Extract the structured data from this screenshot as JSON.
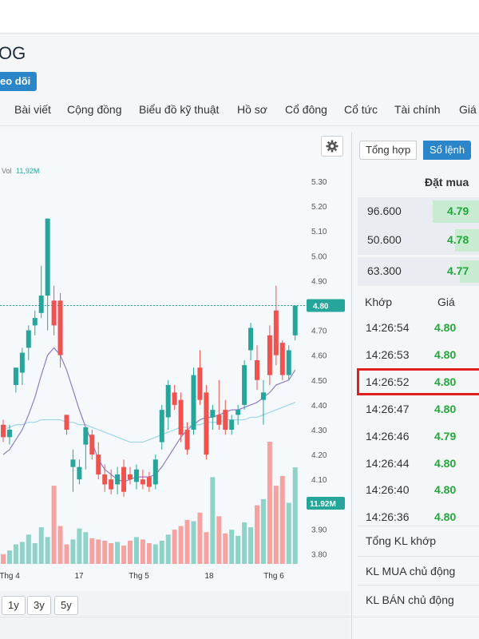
{
  "header": {
    "ticker": "OG",
    "follow_label": "eo dõi"
  },
  "tabs": [
    "Bài viết",
    "Cộng đồng",
    "Biểu đồ kỹ thuật",
    "Hồ sơ",
    "Cổ đông",
    "Cổ tức",
    "Tài chính",
    "Giá"
  ],
  "chart_data": {
    "type": "candlestick",
    "volume_label": "Vol",
    "volume_value": "11,92M",
    "last_price_label": "4.80",
    "last_volume_label": "11.92M",
    "y_ticks": [
      "5.30",
      "5.20",
      "5.10",
      "5.00",
      "4.90",
      "4.80",
      "4.70",
      "4.60",
      "4.50",
      "4.40",
      "4.30",
      "4.20",
      "4.10",
      "4.00",
      "3.90",
      "3.80"
    ],
    "x_ticks": [
      "Thg 4",
      "17",
      "Thg 5",
      "18",
      "Thg 6"
    ],
    "candles": [
      {
        "o": 4.32,
        "h": 4.34,
        "l": 4.25,
        "c": 4.27
      },
      {
        "o": 4.27,
        "h": 4.32,
        "l": 4.24,
        "c": 4.3
      },
      {
        "o": 4.48,
        "h": 4.55,
        "l": 4.45,
        "c": 4.55
      },
      {
        "o": 4.53,
        "h": 4.63,
        "l": 4.48,
        "c": 4.61
      },
      {
        "o": 4.63,
        "h": 4.72,
        "l": 4.58,
        "c": 4.7
      },
      {
        "o": 4.72,
        "h": 4.78,
        "l": 4.68,
        "c": 4.75
      },
      {
        "o": 4.77,
        "h": 4.96,
        "l": 4.75,
        "c": 4.84
      },
      {
        "o": 4.84,
        "h": 5.15,
        "l": 4.7,
        "c": 5.15
      },
      {
        "o": 4.82,
        "h": 4.88,
        "l": 4.68,
        "c": 4.72
      },
      {
        "o": 4.82,
        "h": 4.85,
        "l": 4.55,
        "c": 4.6
      },
      {
        "o": 4.36,
        "h": 4.36,
        "l": 4.28,
        "c": 4.3
      },
      {
        "o": 4.15,
        "h": 4.22,
        "l": 4.05,
        "c": 4.18
      },
      {
        "o": 4.1,
        "h": 4.18,
        "l": 4.08,
        "c": 4.15
      },
      {
        "o": 4.24,
        "h": 4.31,
        "l": 4.14,
        "c": 4.31
      },
      {
        "o": 4.28,
        "h": 4.3,
        "l": 4.18,
        "c": 4.2
      },
      {
        "o": 4.2,
        "h": 4.25,
        "l": 4.1,
        "c": 4.12
      },
      {
        "o": 4.12,
        "h": 4.16,
        "l": 4.05,
        "c": 4.08
      },
      {
        "o": 4.1,
        "h": 4.14,
        "l": 4.04,
        "c": 4.06
      },
      {
        "o": 4.08,
        "h": 4.15,
        "l": 4.04,
        "c": 4.12
      },
      {
        "o": 4.15,
        "h": 4.18,
        "l": 4.03,
        "c": 4.05
      },
      {
        "o": 4.12,
        "h": 4.15,
        "l": 4.08,
        "c": 4.1
      },
      {
        "o": 4.09,
        "h": 4.16,
        "l": 4.06,
        "c": 4.14
      },
      {
        "o": 4.1,
        "h": 4.14,
        "l": 4.06,
        "c": 4.08
      },
      {
        "o": 4.11,
        "h": 4.13,
        "l": 4.05,
        "c": 4.07
      },
      {
        "o": 4.08,
        "h": 4.2,
        "l": 4.06,
        "c": 4.18
      },
      {
        "o": 4.25,
        "h": 4.4,
        "l": 4.22,
        "c": 4.38
      },
      {
        "o": 4.35,
        "h": 4.5,
        "l": 4.3,
        "c": 4.48
      },
      {
        "o": 4.45,
        "h": 4.48,
        "l": 4.38,
        "c": 4.4
      },
      {
        "o": 4.42,
        "h": 4.45,
        "l": 4.25,
        "c": 4.28
      },
      {
        "o": 4.3,
        "h": 4.33,
        "l": 4.2,
        "c": 4.22
      },
      {
        "o": 4.3,
        "h": 4.55,
        "l": 4.28,
        "c": 4.52
      },
      {
        "o": 4.55,
        "h": 4.62,
        "l": 4.4,
        "c": 4.42
      },
      {
        "o": 4.45,
        "h": 4.48,
        "l": 4.18,
        "c": 4.2
      },
      {
        "o": 4.35,
        "h": 4.4,
        "l": 4.3,
        "c": 4.38
      },
      {
        "o": 4.36,
        "h": 4.5,
        "l": 4.3,
        "c": 4.32
      },
      {
        "o": 4.38,
        "h": 4.42,
        "l": 4.28,
        "c": 4.3
      },
      {
        "o": 4.3,
        "h": 4.36,
        "l": 4.28,
        "c": 4.34
      },
      {
        "o": 4.36,
        "h": 4.4,
        "l": 4.32,
        "c": 4.38
      },
      {
        "o": 4.4,
        "h": 4.58,
        "l": 4.38,
        "c": 4.56
      },
      {
        "o": 4.62,
        "h": 4.73,
        "l": 4.58,
        "c": 4.71
      },
      {
        "o": 4.58,
        "h": 4.64,
        "l": 4.46,
        "c": 4.5
      },
      {
        "o": 4.42,
        "h": 4.5,
        "l": 4.32,
        "c": 4.45
      },
      {
        "o": 4.68,
        "h": 4.72,
        "l": 4.48,
        "c": 4.52
      },
      {
        "o": 4.78,
        "h": 4.88,
        "l": 4.56,
        "c": 4.6
      },
      {
        "o": 4.65,
        "h": 4.66,
        "l": 4.5,
        "c": 4.52
      },
      {
        "o": 4.52,
        "h": 4.64,
        "l": 4.5,
        "c": 4.62
      },
      {
        "o": 4.68,
        "h": 4.8,
        "l": 4.66,
        "c": 4.8
      }
    ],
    "volumes": [
      0.8,
      1.1,
      1.6,
      1.8,
      2.4,
      1.7,
      3.0,
      2.2,
      6.4,
      3.1,
      1.6,
      2.0,
      2.9,
      2.6,
      2.1,
      2.0,
      1.9,
      1.7,
      1.8,
      1.5,
      1.9,
      2.2,
      2.0,
      1.7,
      1.6,
      1.9,
      2.4,
      2.8,
      3.1,
      3.6,
      3.5,
      4.2,
      2.6,
      7.1,
      3.9,
      2.5,
      2.8,
      2.3,
      3.4,
      3.0,
      4.8,
      5.3,
      10.0,
      6.4,
      7.2,
      5.0,
      7.9
    ],
    "ma_short": [
      4.2,
      4.22,
      4.26,
      4.3,
      4.36,
      4.43,
      4.52,
      4.6,
      4.63,
      4.6,
      4.54,
      4.46,
      4.38,
      4.31,
      4.25,
      4.18,
      4.14,
      4.12,
      4.1,
      4.09,
      4.1,
      4.11,
      4.11,
      4.11,
      4.12,
      4.15,
      4.19,
      4.23,
      4.27,
      4.3,
      4.32,
      4.34,
      4.35,
      4.35,
      4.36,
      4.37,
      4.38,
      4.38,
      4.39,
      4.4,
      4.41,
      4.43,
      4.45,
      4.48,
      4.49,
      4.5,
      4.54
    ],
    "ma_long": [
      4.3,
      4.31,
      4.32,
      4.32,
      4.33,
      4.33,
      4.34,
      4.34,
      4.34,
      4.34,
      4.33,
      4.33,
      4.32,
      4.32,
      4.31,
      4.3,
      4.29,
      4.28,
      4.27,
      4.26,
      4.25,
      4.25,
      4.25,
      4.26,
      4.27,
      4.28,
      4.29,
      4.3,
      4.31,
      4.31,
      4.32,
      4.32,
      4.33,
      4.33,
      4.33,
      4.34,
      4.34,
      4.34,
      4.34,
      4.35,
      4.35,
      4.36,
      4.37,
      4.38,
      4.39,
      4.4,
      4.41
    ]
  },
  "range_buttons": [
    "1y",
    "3y",
    "5y"
  ],
  "orderbook": {
    "tab_summary": "Tổng hợp",
    "tab_orders": "Sổ lệnh",
    "bid_header": "Đặt mua",
    "bids": [
      {
        "volume": "96.600",
        "price": "4.79",
        "bar": 0.38
      },
      {
        "volume": "50.600",
        "price": "4.78",
        "bar": 0.2
      },
      {
        "volume": "63.300",
        "price": "4.77",
        "bar": 0.16
      }
    ],
    "match_header": "Khớp",
    "price_header": "Giá",
    "trades": [
      {
        "time": "14:26:54",
        "price": "4.80"
      },
      {
        "time": "14:26:53",
        "price": "4.80"
      },
      {
        "time": "14:26:52",
        "price": "4.80"
      },
      {
        "time": "14:26:47",
        "price": "4.80"
      },
      {
        "time": "14:26:46",
        "price": "4.79"
      },
      {
        "time": "14:26:44",
        "price": "4.80"
      },
      {
        "time": "14:26:40",
        "price": "4.80"
      },
      {
        "time": "14:26:36",
        "price": "4.80"
      }
    ],
    "summary": [
      "Tổng KL khớp",
      "KL MUA chủ động",
      "KL BÁN chủ động"
    ]
  },
  "colors": {
    "up": "#26a69a",
    "down": "#ef5350",
    "ma_short": "#8e7cc3",
    "ma_long": "#9fd3ea",
    "accent": "#2a86c8",
    "price_green": "#22a83b"
  }
}
